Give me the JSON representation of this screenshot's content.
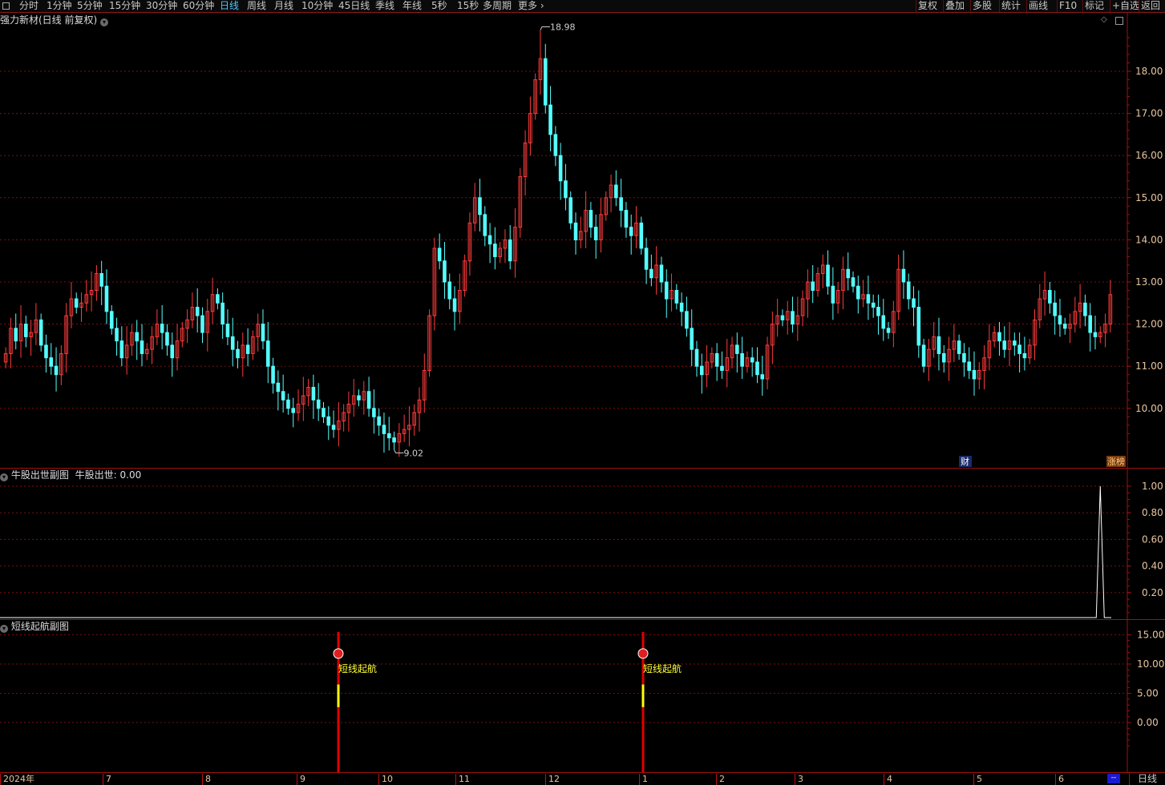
{
  "toolbar": {
    "menu_icon": "square-menu-icon",
    "periods": [
      "分时",
      "1分钟",
      "5分钟",
      "15分钟",
      "30分钟",
      "60分钟",
      "日线",
      "周线",
      "月线",
      "10分钟",
      "45日线",
      "季线",
      "年线",
      "5秒",
      "15秒",
      "多周期",
      "更多"
    ],
    "active_period": "日线",
    "right_buttons": [
      "复权",
      "叠加",
      "多股",
      "统计",
      "画线",
      "F10",
      "标记",
      "+自选",
      "返回"
    ]
  },
  "colors": {
    "up": "#ff3b3b",
    "down": "#54ffff",
    "grid": "#7a1010",
    "panel_border": "#a01010",
    "axis_text": "#e8c6a0",
    "signal_text": "#ffff33",
    "signal_bar_red": "#e00000",
    "signal_bar_yellow": "#ffff00"
  },
  "main_panel": {
    "title": "强力新材(日线 前复权)",
    "title_icon": "chevron-down-icon",
    "toggle_icons": [
      "diamond-icon",
      "square-icon"
    ],
    "price_axis": [
      "18.00",
      "17.00",
      "16.00",
      "15.00",
      "14.00",
      "13.00",
      "12.00",
      "11.00",
      "10.00"
    ],
    "high_label": "18.98",
    "low_label": "9.02",
    "badge_finance": "财",
    "badge_limit": "涨榜"
  },
  "sub_panel_1": {
    "title": "牛股出世副图",
    "value_label": "牛股出世: 0.00",
    "axis": [
      "1.00",
      "0.80",
      "0.60",
      "0.40",
      "0.20"
    ]
  },
  "sub_panel_2": {
    "title": "短线起航副图",
    "axis": [
      "15.00",
      "10.00",
      "5.00",
      "0.00"
    ],
    "signal_label": "短线起航",
    "signal_icon": "signal-ball-icon"
  },
  "date_axis": {
    "ticks": [
      "2024年",
      "7",
      "8",
      "9",
      "10",
      "11",
      "12",
      "1",
      "2",
      "3",
      "4",
      "5",
      "6"
    ],
    "scroll_indicator": "--",
    "period_label": "日线"
  },
  "chart_data": [
    {
      "type": "candlestick",
      "title": "强力新材(日线 前复权)",
      "x_range": [
        "2024-06",
        "2025-06"
      ],
      "ylim": [
        9.0,
        19.0
      ],
      "y_ticks": [
        10,
        11,
        12,
        13,
        14,
        15,
        16,
        17,
        18
      ],
      "annotations": [
        {
          "text": "18.98",
          "type": "max"
        },
        {
          "text": "9.02",
          "type": "min"
        }
      ],
      "closes": [
        11.3,
        11.9,
        11.6,
        12.0,
        11.7,
        11.8,
        12.1,
        11.5,
        11.2,
        11.0,
        10.8,
        11.3,
        12.2,
        12.6,
        12.4,
        12.5,
        12.7,
        12.8,
        13.2,
        12.9,
        12.3,
        11.9,
        11.6,
        11.2,
        11.5,
        11.8,
        11.6,
        11.3,
        11.4,
        11.7,
        12.0,
        11.8,
        11.5,
        11.2,
        11.6,
        11.9,
        12.1,
        12.4,
        12.2,
        11.8,
        12.3,
        12.7,
        12.5,
        12.0,
        11.7,
        11.4,
        11.2,
        11.5,
        11.3,
        11.7,
        12.0,
        11.6,
        11.0,
        10.6,
        10.4,
        10.2,
        10.0,
        9.9,
        10.1,
        10.3,
        10.5,
        10.2,
        10.0,
        9.8,
        9.6,
        9.5,
        9.7,
        9.9,
        10.1,
        10.3,
        10.2,
        10.4,
        10.0,
        9.8,
        9.6,
        9.4,
        9.3,
        9.2,
        9.4,
        9.5,
        9.6,
        9.9,
        10.2,
        10.9,
        12.2,
        13.8,
        13.5,
        13.0,
        12.6,
        12.3,
        12.8,
        13.5,
        14.4,
        15.0,
        14.6,
        14.1,
        13.9,
        13.6,
        13.8,
        14.0,
        13.5,
        14.3,
        15.5,
        16.3,
        17.0,
        17.8,
        18.3,
        17.2,
        16.5,
        16.0,
        15.4,
        15.0,
        14.4,
        14.0,
        14.2,
        14.7,
        14.3,
        14.0,
        14.6,
        15.0,
        15.3,
        15.0,
        14.7,
        14.3,
        14.1,
        14.4,
        13.8,
        13.3,
        13.1,
        13.4,
        13.0,
        12.6,
        12.8,
        12.5,
        12.3,
        11.9,
        11.4,
        11.0,
        10.8,
        11.1,
        11.3,
        11.0,
        10.9,
        11.2,
        11.5,
        11.3,
        11.0,
        11.2,
        11.1,
        10.8,
        10.7,
        11.5,
        12.0,
        12.2,
        12.1,
        12.3,
        12.0,
        12.2,
        12.6,
        13.0,
        12.8,
        13.2,
        13.4,
        12.9,
        12.5,
        12.8,
        13.3,
        13.1,
        12.9,
        12.6,
        12.7,
        12.5,
        12.4,
        12.2,
        11.9,
        11.8,
        12.3,
        13.3,
        13.0,
        12.6,
        12.4,
        11.5,
        11.0,
        11.4,
        11.7,
        11.3,
        11.1,
        11.4,
        11.6,
        11.3,
        11.1,
        10.9,
        10.7,
        10.9,
        11.2,
        11.6,
        11.8,
        11.6,
        11.4,
        11.6,
        11.5,
        11.3,
        11.2,
        11.5,
        12.1,
        12.6,
        12.8,
        12.5,
        12.2,
        12.0,
        11.9,
        12.0,
        12.3,
        12.5,
        12.2,
        11.8,
        11.7,
        11.8,
        12.0,
        12.7
      ],
      "volume_signal_series": {
        "name": "牛股出世",
        "peak_value": 1.0,
        "peak_at_index": 217
      },
      "note": "daily OHLC approximated from visual reading"
    },
    {
      "type": "line",
      "title": "牛股出世副图",
      "series": [
        {
          "name": "牛股出世",
          "values_peak": 1.0,
          "baseline": 0.0
        }
      ],
      "ylim": [
        0,
        1.0
      ]
    },
    {
      "type": "bar",
      "title": "短线起航副图",
      "ylim": [
        -5,
        16
      ],
      "signals": [
        {
          "label": "短线起航",
          "value": 15
        },
        {
          "label": "短线起航",
          "value": 15
        }
      ]
    }
  ]
}
